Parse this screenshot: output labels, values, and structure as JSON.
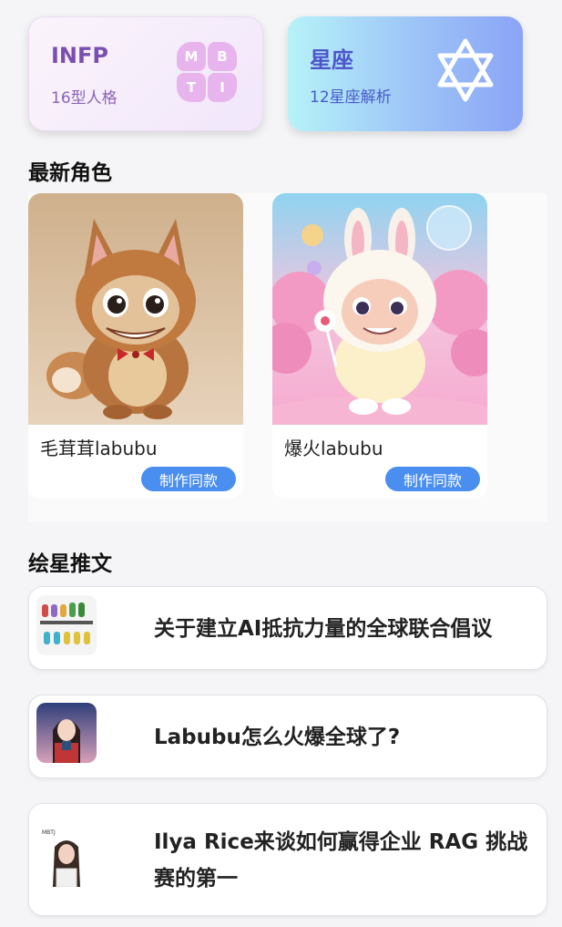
{
  "top_cards": {
    "mbti": {
      "title": "INFP",
      "subtitle": "16型人格",
      "letters": [
        "M",
        "B",
        "T",
        "I"
      ],
      "icon": "mbti-grid-icon",
      "color": "#7b4fb0"
    },
    "star": {
      "title": "星座",
      "subtitle": "12星座解析",
      "icon": "star-of-david-icon",
      "color": "#4e55c8"
    }
  },
  "characters": {
    "heading": "最新角色",
    "items": [
      {
        "name": "毛茸茸labubu",
        "button": "制作同款",
        "image": "brown-fluffy-labubu-figure"
      },
      {
        "name": "爆火labubu",
        "button": "制作同款",
        "image": "white-bunny-labubu-figure"
      }
    ]
  },
  "articles": {
    "heading": "绘星推文",
    "items": [
      {
        "title": "关于建立AI抵抗力量的全球联合倡议",
        "thumb": "mbti-characters-thumbnail"
      },
      {
        "title": "Labubu怎么火爆全球了?",
        "thumb": "anime-girl-thumbnail"
      },
      {
        "title": "Ilya Rice来谈如何赢得企业 RAG 挑战赛的第一",
        "thumb": "woman-portrait-thumbnail"
      }
    ]
  },
  "colors": {
    "accent": "#4a8ef0",
    "background": "#f5f5f7"
  }
}
